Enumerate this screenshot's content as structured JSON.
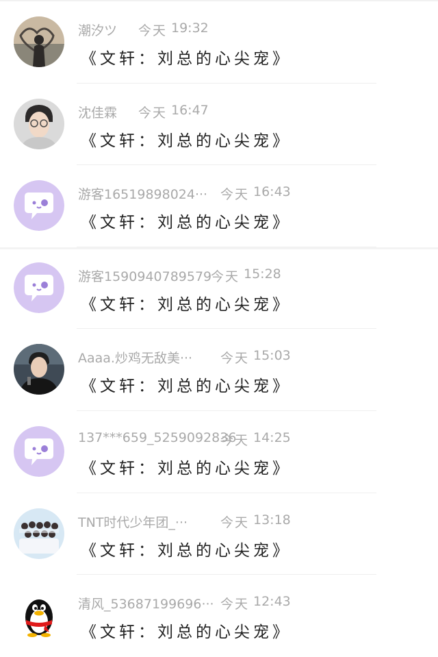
{
  "colors": {
    "meta_text": "#a9a9a9",
    "message_text": "#222222",
    "purple_avatar_bg": "#d6c6f2",
    "purple_bubble_accent": "#9b7fd8"
  },
  "comments": [
    {
      "avatar": "silhouette-heart-photo",
      "name": "潮汐ツ",
      "day": "今天",
      "time": "19:32",
      "message": "《文轩：刘总的心尖宠》"
    },
    {
      "avatar": "young-man-glasses-photo",
      "name": "沈佳霖",
      "day": "今天",
      "time": "16:47",
      "message": "《文轩：刘总的心尖宠》"
    },
    {
      "avatar": "default-chat-bubble-icon",
      "name": "游客16519898024···",
      "day": "今天",
      "time": "16:43",
      "message": "《文轩：刘总的心尖宠》"
    },
    {
      "avatar": "default-chat-bubble-icon",
      "name": "游客1590940789579",
      "day": "今天",
      "time": "15:28",
      "message": "《文轩：刘总的心尖宠》"
    },
    {
      "avatar": "young-man-dark-jacket-photo",
      "name": "Aaaa.炒鸡无敌美···",
      "day": "今天",
      "time": "15:03",
      "message": "《文轩：刘总的心尖宠》"
    },
    {
      "avatar": "default-chat-bubble-icon",
      "name": "137***659_5259092836",
      "day": "今天",
      "time": "14:25",
      "message": "《文轩：刘总的心尖宠》"
    },
    {
      "avatar": "group-photo",
      "name": "TNT时代少年团_···",
      "day": "今天",
      "time": "13:18",
      "message": "《文轩：刘总的心尖宠》"
    },
    {
      "avatar": "qq-penguin-icon",
      "name": "清风_53687199696···",
      "day": "今天",
      "time": "12:43",
      "message": "《文轩：刘总的心尖宠》"
    }
  ]
}
